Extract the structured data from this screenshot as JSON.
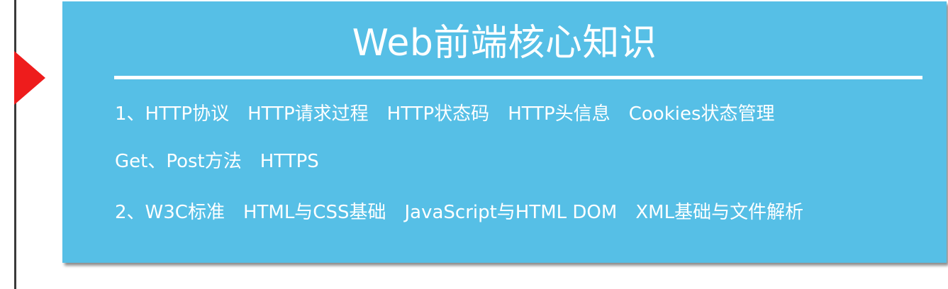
{
  "title": "Web前端核心知识",
  "colors": {
    "card_background": "#56bfe6",
    "marker": "#ee1c1c",
    "timeline": "#3a3a3a",
    "text": "#ffffff"
  },
  "lines": [
    [
      "1、HTTP协议",
      "HTTP请求过程",
      "HTTP状态码",
      "HTTP头信息",
      "Cookies状态管理"
    ],
    [
      "Get、Post方法",
      "HTTPS"
    ],
    [
      "2、W3C标准",
      "HTML与CSS基础",
      "JavaScript与HTML DOM",
      "XML基础与文件解析"
    ]
  ]
}
